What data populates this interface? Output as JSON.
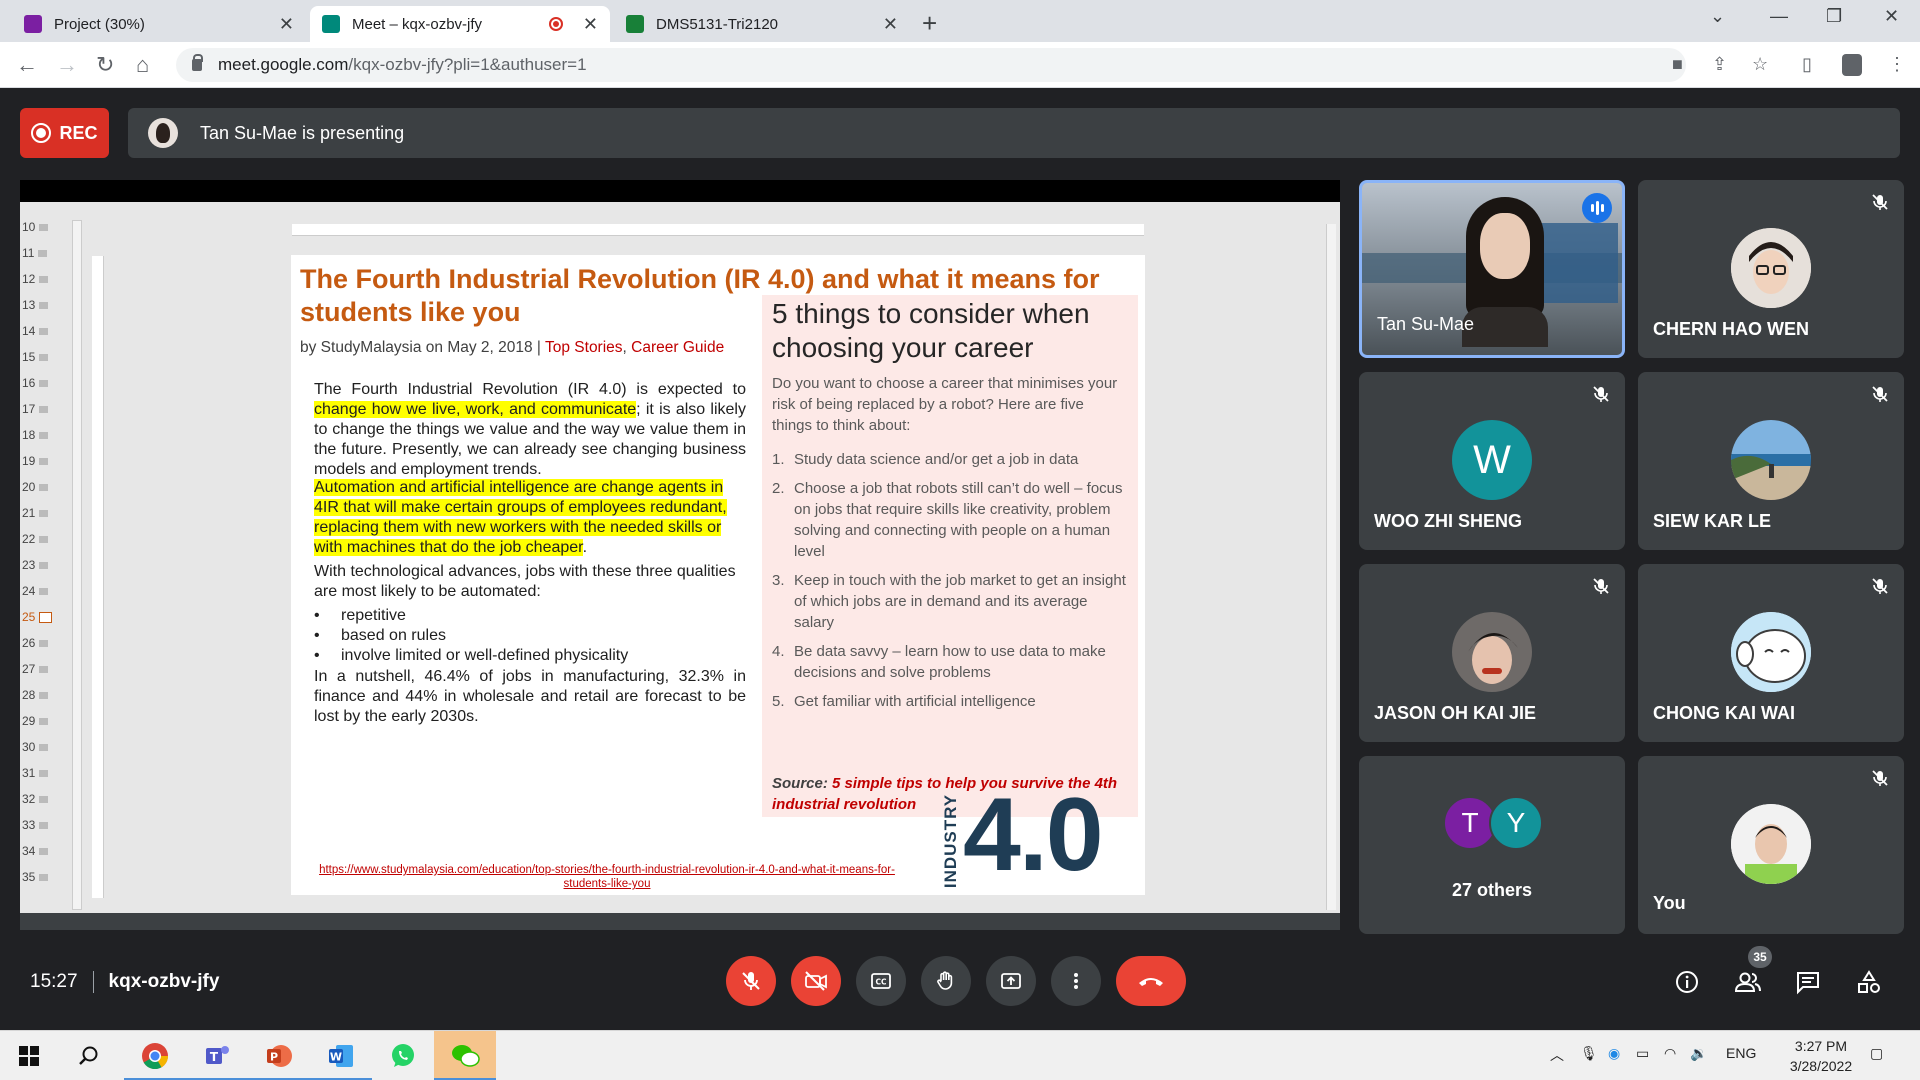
{
  "browser": {
    "tabs": [
      {
        "title": "Project (30%)",
        "favicon_color": "#7b1fa2",
        "active": false
      },
      {
        "title": "Meet – kqx-ozbv-jfy",
        "favicon_color": "#00897b",
        "active": true,
        "recording": true
      },
      {
        "title": "DMS5131-Tri2120",
        "favicon_color": "#188038",
        "active": false
      }
    ],
    "url_host": "meet.google.com",
    "url_path": "/kqx-ozbv-jfy?pli=1&authuser=1"
  },
  "meet": {
    "rec_label": "REC",
    "presenting_text": "Tan Su-Mae is presenting",
    "time": "15:27",
    "meeting_code": "kqx-ozbv-jfy",
    "people_count": "35"
  },
  "slide_panel": {
    "slide_numbers": [
      "10",
      "11",
      "12",
      "13",
      "14",
      "15",
      "16",
      "17",
      "18",
      "19",
      "20",
      "21",
      "22",
      "23",
      "24",
      "25",
      "26",
      "27",
      "28",
      "29",
      "30",
      "31",
      "32",
      "33",
      "34",
      "35"
    ],
    "current_slide": "25"
  },
  "slide": {
    "headline": "The Fourth Industrial Revolution (IR 4.0) and what it means for students like you",
    "byline_prefix": "by StudyMalaysia on May 2, 2018 | ",
    "byline_link1": "Top Stories",
    "byline_sep": ", ",
    "byline_link2": "Career Guide",
    "p1_a": "The Fourth Industrial Revolution (IR 4.0) is expected to ",
    "p1_hl": "change how we live, work, and communicate",
    "p1_b": "; it is also likely to change the things we value and the way we value them in the future. Presently, we can already see changing business models and employment trends.",
    "p2_hl": "Automation and artificial intelligence are change agents in 4IR that will make certain groups of employees redundant, replacing them with new workers with the needed skills or with machines that do the job cheaper",
    "p2_end": ".",
    "p3": "With technological advances, jobs with these three qualities are most likely to be automated:",
    "bullets": [
      "repetitive",
      "based on rules",
      "involve limited or well-defined physicality"
    ],
    "p4": "In a nutshell, 46.4% of jobs in manufacturing, 32.3% in finance and 44% in wholesale and retail are forecast to be lost by the early 2030s.",
    "right_title": "5 things to consider when choosing your career",
    "right_intro": "Do you want to choose a career that minimises your risk of being replaced by a robot? Here are five things to think about:",
    "right_items": [
      {
        "n": "1.",
        "text": "Study data science and/or get a job in data"
      },
      {
        "n": "2.",
        "text": "Choose a job that robots still can’t do well – focus on jobs that require skills like creativity, problem solving and connecting with people on a human level"
      },
      {
        "n": "3.",
        "text": "Keep in touch with the job market to get an insight of which jobs are in demand and its average salary"
      },
      {
        "n": "4.",
        "text": "Be data savvy – learn how to use data to make decisions and solve problems"
      },
      {
        "n": "5.",
        "text": "Get familiar with artificial intelligence"
      }
    ],
    "source_label": "Source: ",
    "source_text": "5 simple tips to help you survive the 4th industrial revolution",
    "url": "https://www.studymalaysia.com/education/top-stories/the-fourth-industrial-revolution-ir-4.0-and-what-it-means-for-students-like-you",
    "logo_word": "INDUSTRY",
    "logo_num": "4.0"
  },
  "participants": [
    {
      "name": "Tan Su-Mae",
      "speaking": true
    },
    {
      "name": "CHERN HAO WEN",
      "muted": true
    },
    {
      "name": "WOO ZHI SHENG",
      "muted": true,
      "initial": "W",
      "color": "#12939a"
    },
    {
      "name": "SIEW KAR LE",
      "muted": true
    },
    {
      "name": "JASON OH KAI JIE",
      "muted": true
    },
    {
      "name": "CHONG KAI WAI",
      "muted": true
    },
    {
      "name": "27 others",
      "initials": [
        "T",
        "Y"
      ],
      "colors": [
        "#7b1fa2",
        "#12939a"
      ]
    },
    {
      "name": "You",
      "muted": true
    }
  ],
  "taskbar": {
    "lang": "ENG",
    "time": "3:27 PM",
    "date": "3/28/2022"
  },
  "colors": {
    "rec_red": "#d93025",
    "hangup_red": "#ea4335",
    "slide_orange": "#c55a11",
    "highlight_yellow": "#ffff00",
    "speaker_blue": "#8ab4f8"
  }
}
